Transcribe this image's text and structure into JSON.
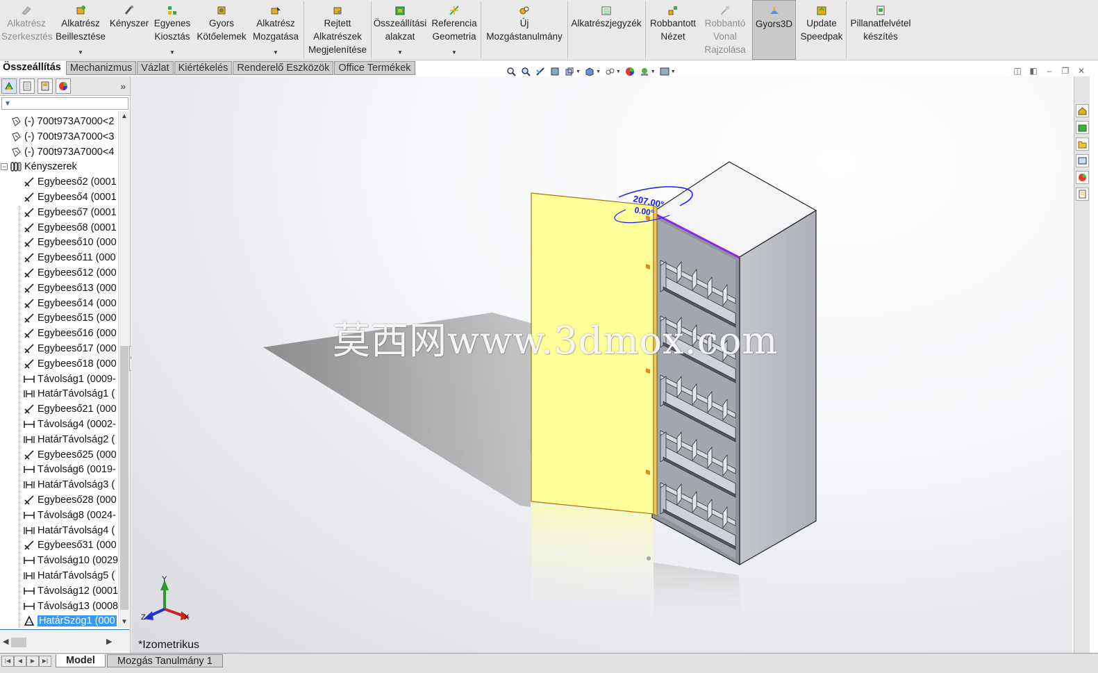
{
  "ribbon": {
    "buttons": [
      {
        "label": "Alkatrész Szerkesztés",
        "icon": "edit-part-icon",
        "disabled": true
      },
      {
        "label": "Alkatrész Beillesztése",
        "icon": "insert-component-icon",
        "dropdown": true
      },
      {
        "label": "Kényszer",
        "icon": "mate-icon"
      },
      {
        "label": "Egyenes Kiosztás",
        "icon": "linear-pattern-icon",
        "dropdown": true
      },
      {
        "label": "Gyors Kötőelemek",
        "icon": "smart-fasteners-icon"
      },
      {
        "label": "Alkatrész Mozgatása",
        "icon": "move-component-icon",
        "dropdown": true
      },
      {
        "label": "Rejtett Alkatrészek Megjelenítése",
        "icon": "show-hidden-components-icon"
      },
      {
        "label": "Összeállítási alakzat",
        "icon": "assembly-features-icon",
        "dropdown": true
      },
      {
        "label": "Referencia Geometria",
        "icon": "reference-geometry-icon",
        "dropdown": true
      },
      {
        "label": "Új Mozgástanulmány",
        "icon": "new-motion-study-icon"
      },
      {
        "label": "Alkatrészjegyzék",
        "icon": "bill-of-materials-icon"
      },
      {
        "label": "Robbantott Nézet",
        "icon": "exploded-view-icon"
      },
      {
        "label": "Robbantó Vonal Rajzolása",
        "icon": "explode-line-sketch-icon",
        "disabled": true
      },
      {
        "label": "Gyors3D",
        "icon": "instant3d-icon",
        "active": true
      },
      {
        "label": "Update Speedpak",
        "icon": "update-speedpak-icon"
      },
      {
        "label": "Pillanatfelvétel készítés",
        "icon": "take-snapshot-icon"
      }
    ]
  },
  "command_tabs": [
    "Összeállítás",
    "Mechanizmus",
    "Vázlat",
    "Kiértékelés",
    "Renderelő Eszközök",
    "Office Termékek"
  ],
  "tree": {
    "items": [
      {
        "label": "(-) 700t973A7000<2",
        "icon": "part-icon",
        "indent": 0
      },
      {
        "label": "(-) 700t973A7000<3",
        "icon": "part-icon",
        "indent": 0
      },
      {
        "label": "(-) 700t973A7000<4",
        "icon": "part-icon",
        "indent": 0
      },
      {
        "label": "Kényszerek",
        "icon": "mates-folder-icon",
        "indent": 0,
        "expander": "−"
      },
      {
        "label": "Egybeeső2 (0001",
        "icon": "coincident-icon",
        "indent": 1
      },
      {
        "label": "Egybeeső4 (0001",
        "icon": "coincident-icon",
        "indent": 1
      },
      {
        "label": "Egybeeső7 (0001",
        "icon": "coincident-icon",
        "indent": 1
      },
      {
        "label": "Egybeeső8 (0001",
        "icon": "coincident-icon",
        "indent": 1
      },
      {
        "label": "Egybeeső10 (000",
        "icon": "coincident-icon",
        "indent": 1
      },
      {
        "label": "Egybeeső11 (000",
        "icon": "coincident-icon",
        "indent": 1
      },
      {
        "label": "Egybeeső12 (000",
        "icon": "coincident-icon",
        "indent": 1
      },
      {
        "label": "Egybeeső13 (000",
        "icon": "coincident-icon",
        "indent": 1
      },
      {
        "label": "Egybeeső14 (000",
        "icon": "coincident-icon",
        "indent": 1
      },
      {
        "label": "Egybeeső15 (000",
        "icon": "coincident-icon",
        "indent": 1
      },
      {
        "label": "Egybeeső16 (000",
        "icon": "coincident-icon",
        "indent": 1
      },
      {
        "label": "Egybeeső17 (000",
        "icon": "coincident-icon",
        "indent": 1
      },
      {
        "label": "Egybeeső18 (000",
        "icon": "coincident-icon",
        "indent": 1
      },
      {
        "label": "Távolság1 (0009-",
        "icon": "distance-icon",
        "indent": 1
      },
      {
        "label": "HatárTávolság1 (",
        "icon": "limit-distance-icon",
        "indent": 1
      },
      {
        "label": "Egybeeső21 (000",
        "icon": "coincident-icon",
        "indent": 1
      },
      {
        "label": "Távolság4 (0002-",
        "icon": "distance-icon",
        "indent": 1
      },
      {
        "label": "HatárTávolság2 (",
        "icon": "limit-distance-icon",
        "indent": 1
      },
      {
        "label": "Egybeeső25 (000",
        "icon": "coincident-icon",
        "indent": 1
      },
      {
        "label": "Távolság6 (0019-",
        "icon": "distance-icon",
        "indent": 1
      },
      {
        "label": "HatárTávolság3 (",
        "icon": "limit-distance-icon",
        "indent": 1
      },
      {
        "label": "Egybeeső28 (000",
        "icon": "coincident-icon",
        "indent": 1
      },
      {
        "label": "Távolság8 (0024-",
        "icon": "distance-icon",
        "indent": 1
      },
      {
        "label": "HatárTávolság4 (",
        "icon": "limit-distance-icon",
        "indent": 1
      },
      {
        "label": "Egybeeső31 (000",
        "icon": "coincident-icon",
        "indent": 1
      },
      {
        "label": "Távolság10 (0029",
        "icon": "distance-icon",
        "indent": 1
      },
      {
        "label": "HatárTávolság5 (",
        "icon": "limit-distance-icon",
        "indent": 1
      },
      {
        "label": "Távolság12 (0001",
        "icon": "distance-icon",
        "indent": 1
      },
      {
        "label": "Távolság13 (0008",
        "icon": "distance-icon",
        "indent": 1
      },
      {
        "label": "HatárSzög1 (000",
        "icon": "limit-angle-icon",
        "indent": 1,
        "selected": true
      }
    ]
  },
  "viewport": {
    "view_name": "*Izometrikus",
    "dimension_primary": "207.00°",
    "dimension_secondary": "0.00°",
    "watermark": "莫西网www.3dmox.com",
    "axes": {
      "x": "X",
      "y": "Y",
      "z": "Z"
    }
  },
  "bottom_tabs": [
    "Model",
    "Mozgás Tanulmány 1"
  ],
  "colors": {
    "door": "#ffff99",
    "selection_edge": "#8a2be2",
    "dimension": "#1a1aff",
    "accent": "#3399ff"
  }
}
